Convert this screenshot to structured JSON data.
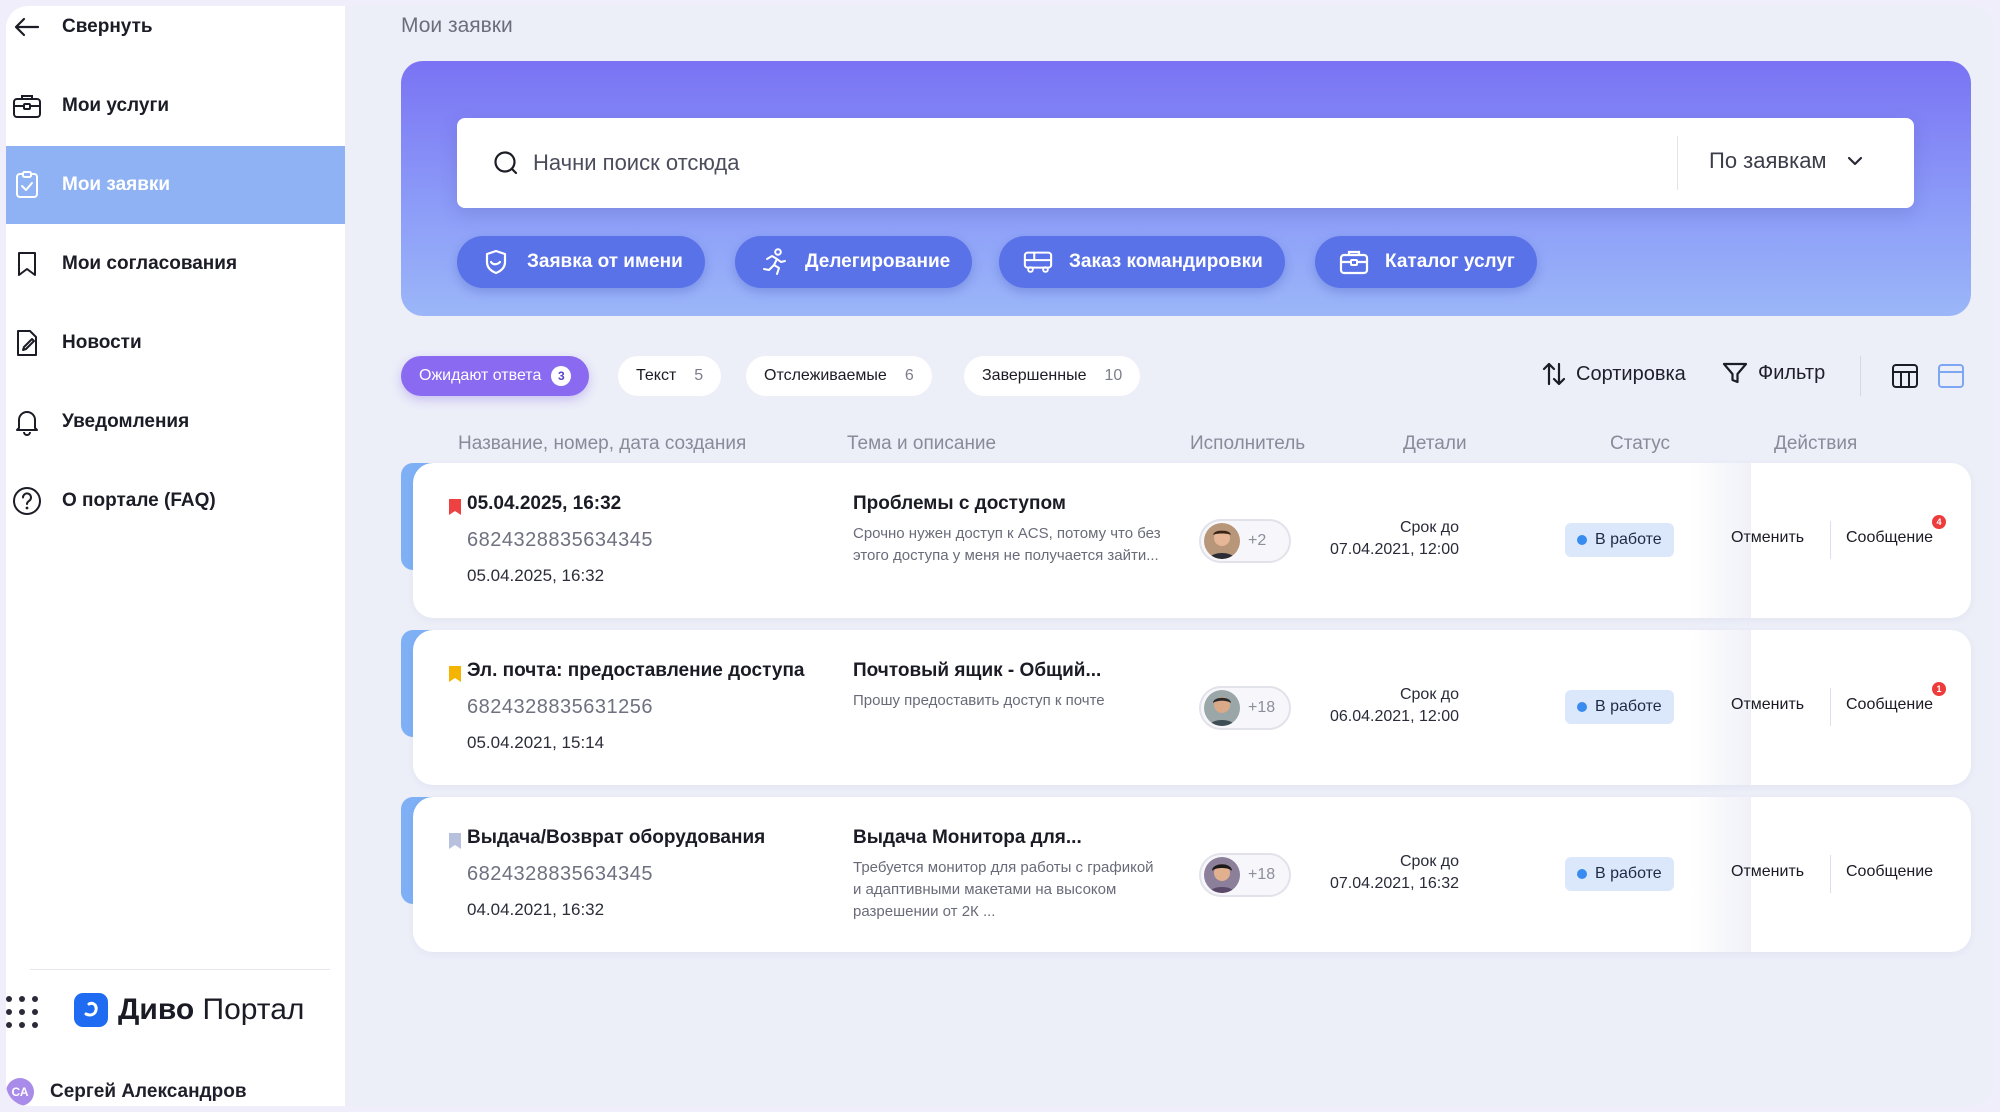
{
  "sidebar": {
    "collapse_label": "Свернуть",
    "items": [
      {
        "label": "Мои услуги",
        "icon": "briefcase-icon"
      },
      {
        "label": "Мои заявки",
        "icon": "clipboard-check-icon",
        "active": true
      },
      {
        "label": "Мои согласования",
        "icon": "bookmark-icon"
      },
      {
        "label": "Новости",
        "icon": "document-pen-icon"
      },
      {
        "label": "Уведомления",
        "icon": "bell-icon"
      },
      {
        "label": "О портале (FAQ)",
        "icon": "question-icon"
      }
    ],
    "logo_brand": "Диво",
    "logo_product": "Портал",
    "user_initials": "СА",
    "user_name": "Сергей Александров"
  },
  "page_title": "Мои заявки",
  "search": {
    "placeholder": "Начни поиск отсюда",
    "scope": "По заявкам"
  },
  "quick_actions": [
    {
      "label": "Заявка от имени",
      "icon": "shield-icon"
    },
    {
      "label": "Делегирование",
      "icon": "runner-icon"
    },
    {
      "label": "Заказ командировки",
      "icon": "bus-icon"
    },
    {
      "label": "Каталог услуг",
      "icon": "briefcase-icon"
    }
  ],
  "tabs": [
    {
      "label": "Ожидают ответа",
      "count": "3",
      "active": true
    },
    {
      "label": "Текст",
      "count": "5"
    },
    {
      "label": "Отслеживаемые",
      "count": "6"
    },
    {
      "label": "Завершенные",
      "count": "10"
    }
  ],
  "toolbar": {
    "sort_label": "Сортировка",
    "filter_label": "Фильтр"
  },
  "table": {
    "headers": [
      "Название, номер, дата создания",
      "Тема и описание",
      "Исполнитель",
      "Детали",
      "Статус",
      "Действия"
    ],
    "rows": [
      {
        "flag_color": "#ee4141",
        "title": "05.04.2025, 16:32",
        "number": "6824328835634345",
        "date": "05.04.2025, 16:32",
        "topic": "Проблемы с доступом",
        "description": "Срочно нужен доступ к ACS, потому что без этого доступа у меня не получается зайти...",
        "assignee_more": "+2",
        "due_label": "Срок до",
        "due_date": "07.04.2021, 12:00",
        "status": "В работе",
        "cancel": "Отменить",
        "message": "Сообщение",
        "message_badge": "4"
      },
      {
        "flag_color": "#f4b400",
        "title": "Эл. почта: предоставление доступа",
        "number": "6824328835631256",
        "date": "05.04.2021, 15:14",
        "topic": "Почтовый ящик - Общий...",
        "description": "Прошу предоставить доступ к почте",
        "assignee_more": "+18",
        "due_label": "Срок до",
        "due_date": "06.04.2021, 12:00",
        "status": "В работе",
        "cancel": "Отменить",
        "message": "Сообщение",
        "message_badge": "1"
      },
      {
        "flag_color": "#b7c1dd",
        "title": "Выдача/Возврат оборудования",
        "number": "6824328835634345",
        "date": "04.04.2021, 16:32",
        "topic": "Выдача Монитора для...",
        "description": "Требуется монитор для работы с графикой и адаптивными макетами на высоком разрешении от 2К ...",
        "assignee_more": "+18",
        "due_label": "Срок до",
        "due_date": "07.04.2021, 16:32",
        "status": "В работе",
        "cancel": "Отменить",
        "message": "Сообщение",
        "message_badge": ""
      }
    ]
  }
}
